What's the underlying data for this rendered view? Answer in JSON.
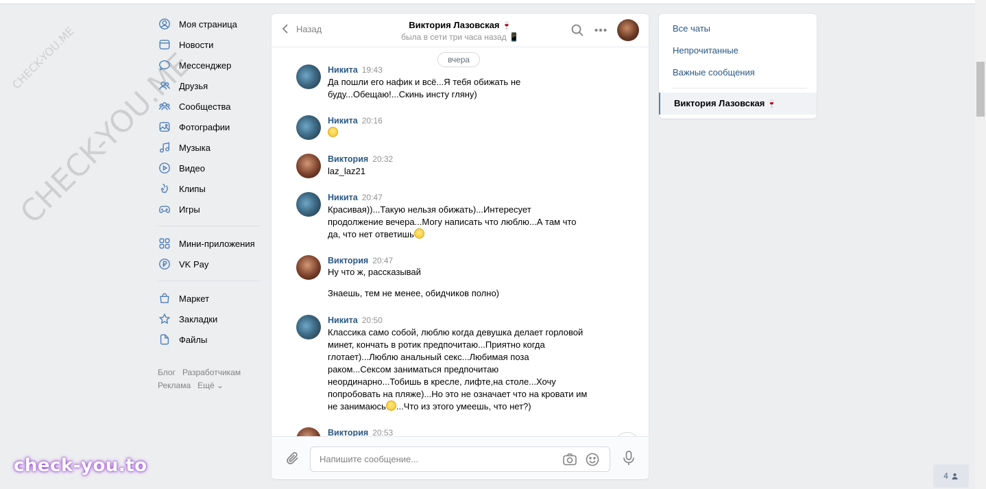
{
  "watermark": {
    "small": "CHECK-YOU.ME",
    "large": "CHECK-YOU.ME",
    "brand": "check-you.to"
  },
  "nav": {
    "items": [
      {
        "label": "Моя страница",
        "icon": "user-circle-icon"
      },
      {
        "label": "Новости",
        "icon": "news-icon"
      },
      {
        "label": "Мессенджер",
        "icon": "chat-bubble-icon"
      },
      {
        "label": "Друзья",
        "icon": "friends-icon"
      },
      {
        "label": "Сообщества",
        "icon": "groups-icon"
      },
      {
        "label": "Фотографии",
        "icon": "photo-icon"
      },
      {
        "label": "Музыка",
        "icon": "music-note-icon"
      },
      {
        "label": "Видео",
        "icon": "video-play-icon"
      },
      {
        "label": "Клипы",
        "icon": "clips-icon"
      },
      {
        "label": "Игры",
        "icon": "gamepad-icon"
      }
    ],
    "items2": [
      {
        "label": "Мини-приложения",
        "icon": "apps-grid-icon"
      },
      {
        "label": "VK Pay",
        "icon": "vkpay-icon"
      }
    ],
    "items3": [
      {
        "label": "Маркет",
        "icon": "market-bag-icon"
      },
      {
        "label": "Закладки",
        "icon": "star-icon"
      },
      {
        "label": "Файлы",
        "icon": "file-icon"
      }
    ],
    "footer": {
      "blog": "Блог",
      "dev": "Разработчикам",
      "ads": "Реклама",
      "more": "Ещё ⌄"
    }
  },
  "chat": {
    "back": "Назад",
    "peer_name": "Виктория Лазовская",
    "peer_emoji": "🍷",
    "peer_status": "была в сети три часа назад 📱",
    "date_chip": "вчера",
    "messages": [
      {
        "author": "Никита",
        "time": "19:43",
        "text": "Да пошли его нафик и всё...Я тебя обижать не\nбуду...Обещаю!...Скинь инсту гляну)"
      },
      {
        "author": "Никита",
        "time": "20:16",
        "text": ""
      },
      {
        "author": "Виктория",
        "time": "20:32",
        "text": "laz_laz21"
      },
      {
        "author": "Никита",
        "time": "20:47",
        "text": "Красивая))...Такую нельзя обижать)...Интересует\nпродолжение вечера...Могу написать что люблю...А там что\nда, что нет ответишь"
      },
      {
        "author": "Виктория",
        "time": "20:47",
        "text": "Ну что ж, рассказывай\n\nЗнаешь, тем не менее, обидчиков полно)"
      },
      {
        "author": "Никита",
        "time": "20:50",
        "text_a": "Классика само собой, люблю когда девушка делает горловой\nминет, кончать в ротик предпочитаю...Приятно когда\nглотает)...Люблю анальный секс...Любимая поза\nраком...Сексом заниматься предпочитаю\nнеординарно...Тобишь в кресле, лифте,на столе...Хочу\nпопробовать на пляже)...Но это не означает что на кровати им\nне занимаюсь",
        "text_b": "...Что из этого умеешь, что нет?)"
      },
      {
        "author": "Виктория",
        "time": "20:53",
        "text": ""
      }
    ],
    "composer_placeholder": "Напишите сообщение..."
  },
  "right": {
    "filters": [
      "Все чаты",
      "Непрочитанные",
      "Важные сообщения"
    ],
    "active_conv": "Виктория Лазовская",
    "active_conv_emoji": "🍷"
  },
  "online_count": "4"
}
